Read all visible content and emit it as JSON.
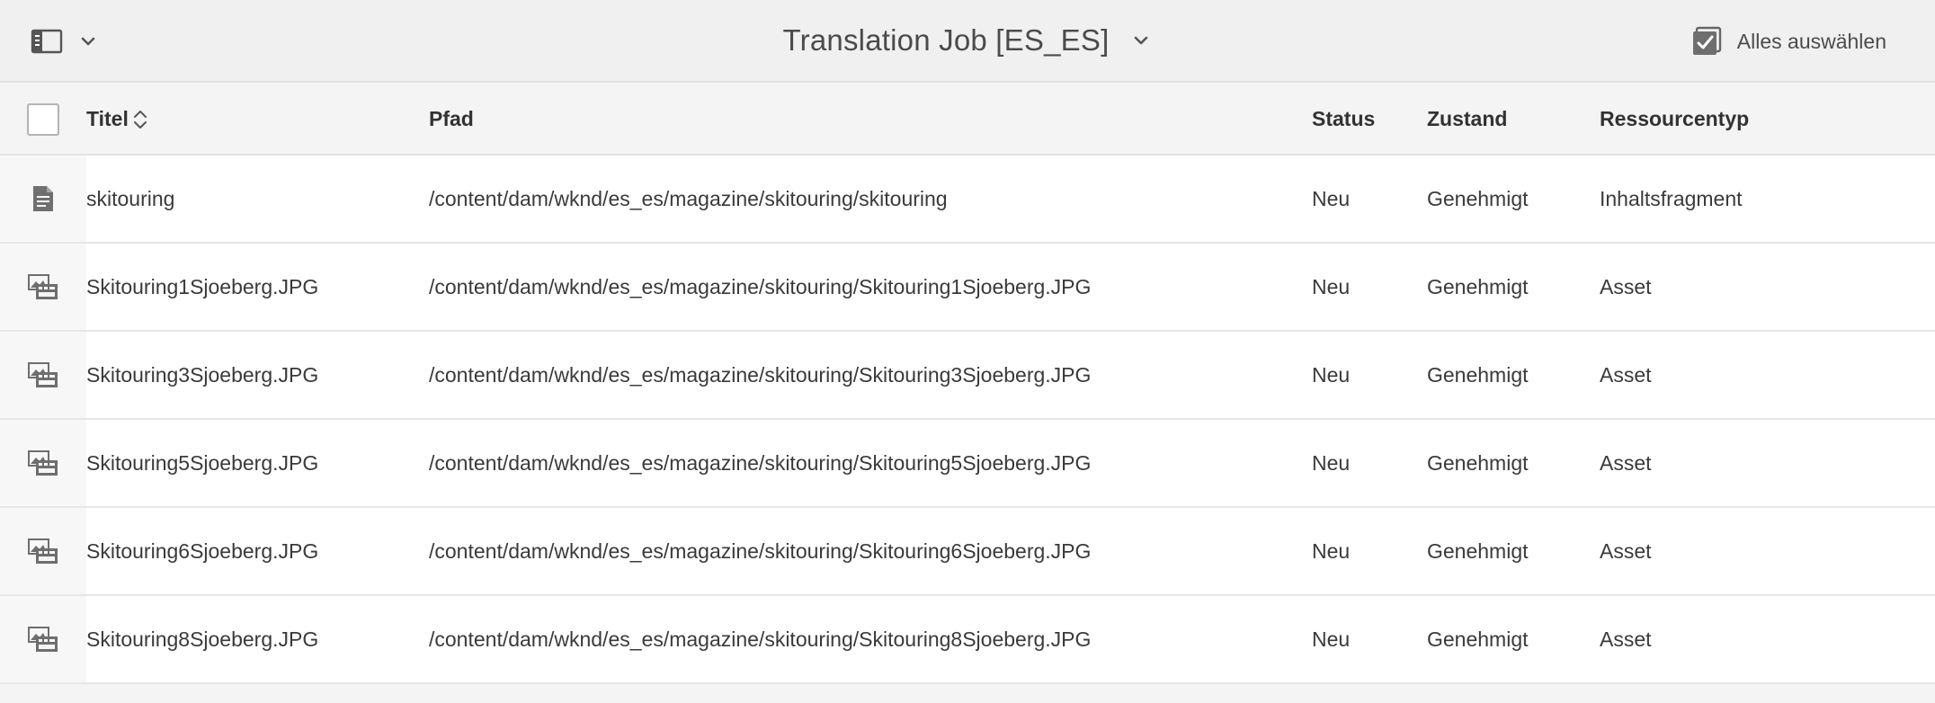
{
  "toolbar": {
    "title": "Translation Job [ES_ES]",
    "select_all_label": "Alles auswählen"
  },
  "columns": {
    "title": "Titel",
    "path": "Pfad",
    "status": "Status",
    "state": "Zustand",
    "type": "Ressourcentyp"
  },
  "rows": [
    {
      "icon": "document-icon",
      "title": "skitouring",
      "path": "/content/dam/wknd/es_es/magazine/skitouring/skitouring",
      "status": "Neu",
      "state": "Genehmigt",
      "type": "Inhaltsfragment"
    },
    {
      "icon": "image-asset-icon",
      "title": "Skitouring1Sjoeberg.JPG",
      "path": "/content/dam/wknd/es_es/magazine/skitouring/Skitouring1Sjoeberg.JPG",
      "status": "Neu",
      "state": "Genehmigt",
      "type": "Asset"
    },
    {
      "icon": "image-asset-icon",
      "title": "Skitouring3Sjoeberg.JPG",
      "path": "/content/dam/wknd/es_es/magazine/skitouring/Skitouring3Sjoeberg.JPG",
      "status": "Neu",
      "state": "Genehmigt",
      "type": "Asset"
    },
    {
      "icon": "image-asset-icon",
      "title": "Skitouring5Sjoeberg.JPG",
      "path": "/content/dam/wknd/es_es/magazine/skitouring/Skitouring5Sjoeberg.JPG",
      "status": "Neu",
      "state": "Genehmigt",
      "type": "Asset"
    },
    {
      "icon": "image-asset-icon",
      "title": "Skitouring6Sjoeberg.JPG",
      "path": "/content/dam/wknd/es_es/magazine/skitouring/Skitouring6Sjoeberg.JPG",
      "status": "Neu",
      "state": "Genehmigt",
      "type": "Asset"
    },
    {
      "icon": "image-asset-icon",
      "title": "Skitouring8Sjoeberg.JPG",
      "path": "/content/dam/wknd/es_es/magazine/skitouring/Skitouring8Sjoeberg.JPG",
      "status": "Neu",
      "state": "Genehmigt",
      "type": "Asset"
    }
  ],
  "icons": {
    "rail_toggle": "rail-toggle-icon",
    "chevron": "chevron-down-icon",
    "select_all": "select-all-checkbox-icon",
    "sort": "sort-icon"
  },
  "colors": {
    "header_bg": "#f0f0f0",
    "row_bg": "#ffffff",
    "text": "#323232",
    "icon": "#6e6e6e"
  }
}
